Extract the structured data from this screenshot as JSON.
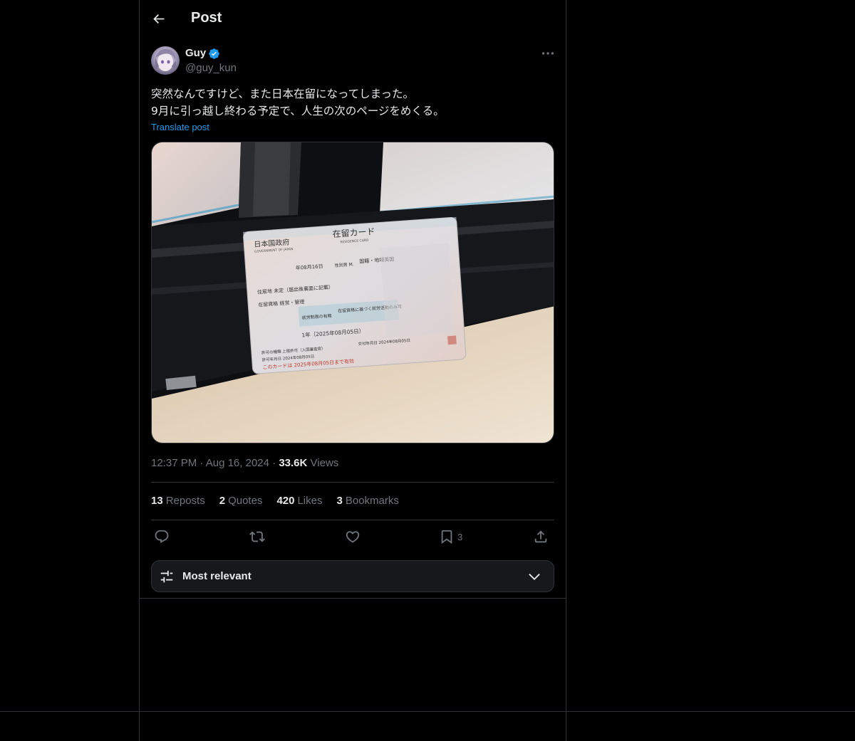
{
  "header": {
    "title": "Post"
  },
  "author": {
    "name": "Guy",
    "handle": "@guy_kun"
  },
  "post": {
    "line1": "突然なんですけど、また日本在留になってしまった。",
    "line2": "9月に引っ越し終わる予定で、人生の次のページをめくる。",
    "translate_label": "Translate post",
    "time": "12:37 PM",
    "date": "Aug 16, 2024",
    "views_count": "33.6K",
    "views_label": "Views"
  },
  "stats": {
    "reposts_count": "13",
    "reposts_label": "Reposts",
    "quotes_count": "2",
    "quotes_label": "Quotes",
    "likes_count": "420",
    "likes_label": "Likes",
    "bookmarks_count": "3",
    "bookmarks_label": "Bookmarks"
  },
  "actions": {
    "bookmark_count": "3"
  },
  "sort": {
    "label": "Most relevant"
  },
  "card": {
    "title_jp": "在留カード",
    "title_en": "RESIDENCE CARD",
    "gov_jp": "日本国政府",
    "gov_en": "GOVERNMENT OF JAPAN",
    "dob": "年08月16日",
    "sex": "性別男 M.",
    "nationality": "国籍・地域英国",
    "address": "住居地 未定（届出後裏面に記載）",
    "status": "在留資格 経営・管理",
    "work_restriction": "就労制限の有無",
    "work_note": "在留資格に基づく就労活動のみ可",
    "period": "1年（2025年08月05日）",
    "permit_type": "許可の種類 上陸許可（入国審査官）",
    "permit_date": "許可年月日 2024年08月05日",
    "issue_date": "交付年月日 2024年08月05日",
    "expiry": "このカードは 2025年08月05日まで有効"
  },
  "colors": {
    "accent": "#1d9bf0",
    "muted": "#71767b",
    "text": "#e7e9ea",
    "border": "#2f3336"
  }
}
